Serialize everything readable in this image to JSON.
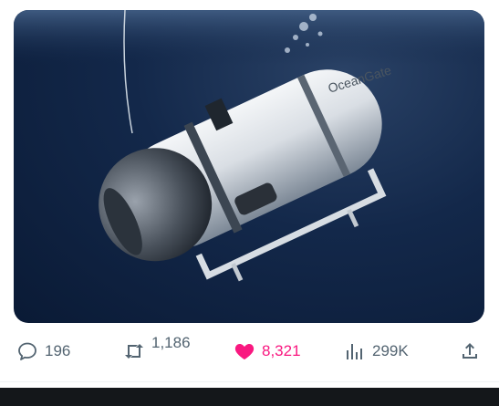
{
  "media": {
    "alt": "Submersible photo",
    "hull_text": "OceanGate"
  },
  "actions": {
    "reply": {
      "icon": "reply-icon",
      "count": "196"
    },
    "retweet": {
      "icon": "retweet-icon",
      "count": "1,186"
    },
    "like": {
      "icon": "heart-icon",
      "count": "8,321",
      "liked": true,
      "color": "#f91880"
    },
    "views": {
      "icon": "views-chart-icon",
      "count": "299K"
    },
    "share": {
      "icon": "share-icon"
    }
  },
  "colors": {
    "muted": "#536471",
    "like": "#f91880",
    "bottom_bar": "#14171a"
  }
}
